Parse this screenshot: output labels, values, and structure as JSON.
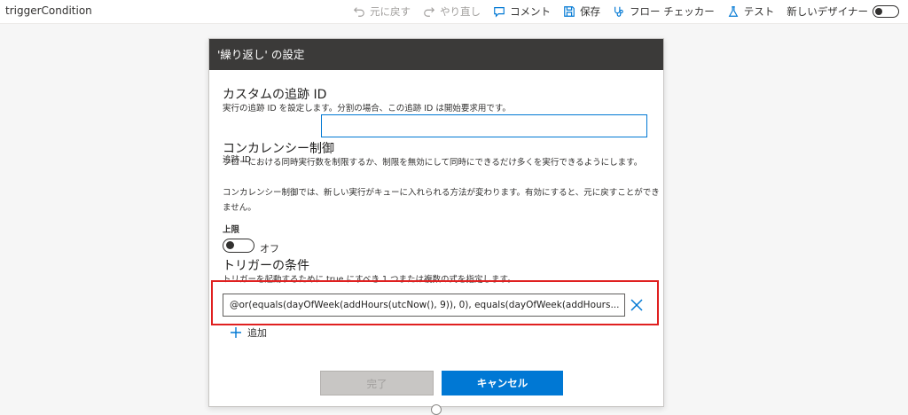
{
  "topbar": {
    "flow_name": "triggerCondition",
    "undo": "元に戻す",
    "redo": "やり直し",
    "comment": "コメント",
    "save": "保存",
    "checker": "フロー チェッカー",
    "test": "テスト",
    "new_designer": "新しいデザイナー"
  },
  "dialog": {
    "title": "'繰り返し' の設定",
    "tracking": {
      "title": "カスタムの追跡 ID",
      "desc": "実行の追跡 ID を設定します。分割の場合、この追跡 ID は開始要求用です。",
      "label": "追跡 ID",
      "value": ""
    },
    "concurrency": {
      "title": "コンカレンシー制御",
      "desc1": "フローにおける同時実行数を制限するか、制限を無効にして同時にできるだけ多くを実行できるようにします。",
      "desc2": "コンカレンシー制御では、新しい実行がキューに入れられる方法が変わります。有効にすると、元に戻すことができません。",
      "limit_label": "上限",
      "toggle_state": "オフ"
    },
    "trigger": {
      "title": "トリガーの条件",
      "desc": "トリガーを起動するために true にすべき 1 つまたは複数の式を指定します。",
      "condition": "@or(equals(dayOfWeek(addHours(utcNow(), 9)), 0), equals(dayOfWeek(addHours...",
      "add_label": "追加"
    },
    "done_label": "完了",
    "cancel_label": "キャンセル"
  },
  "colors": {
    "accent": "#0078d4",
    "header": "#3b3a39",
    "highlight": "#e02020"
  }
}
